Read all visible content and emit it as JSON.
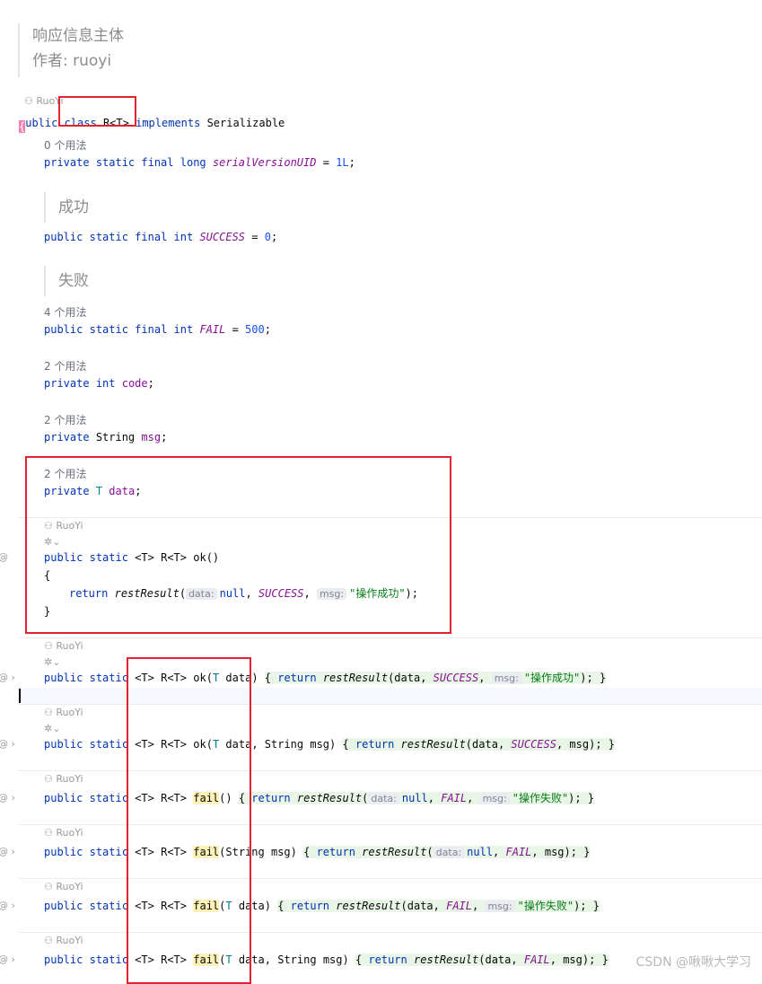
{
  "javadoc_class": {
    "line1": "响应信息主体",
    "line2": "作者: ruoyi"
  },
  "author": "RuoYi",
  "usages": {
    "zero": "0 个用法",
    "four": "4 个用法",
    "two": "2 个用法"
  },
  "docs": {
    "success": "成功",
    "fail": "失败"
  },
  "code": {
    "class_kw": "public",
    "class_decl": "class",
    "class_name": "R<T>",
    "implements": "implements",
    "serializable": "Serializable",
    "open_brace": "{",
    "close_brace": "}",
    "private_kw": "private",
    "public_kw": "public",
    "static_final": "static final",
    "long_kw": "long",
    "int_kw": "int",
    "string_type": "String",
    "t_type": "T",
    "static_kw": "static",
    "generic": "<T>",
    "return_type": "R<T>",
    "return_kw": "return",
    "serial_field": "serialVersionUID",
    "serial_value": "1L",
    "success_field": "SUCCESS",
    "success_value": "0",
    "fail_field": "FAIL",
    "fail_value": "500",
    "code_field": "code",
    "msg_field": "msg",
    "data_field": "data",
    "ok": "ok",
    "fail": "fail",
    "rest_result": "restResult",
    "null_kw": "null",
    "success_msg": "\"操作成功\"",
    "fail_msg": "\"操作失败\"",
    "data_param": "data",
    "msg_param": "msg"
  },
  "hints": {
    "data": "data:",
    "msg": "msg:"
  },
  "gutter_icon": "@",
  "watermark": "CSDN @啾啾大学习"
}
